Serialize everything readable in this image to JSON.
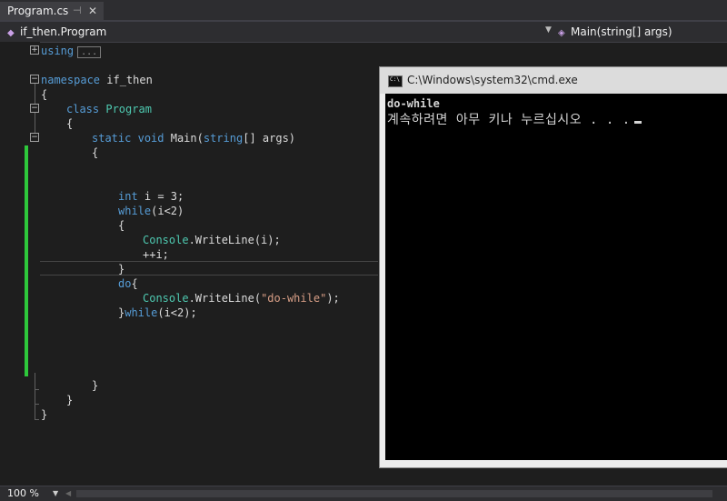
{
  "tab": {
    "label": "Program.cs",
    "pin": "⊣",
    "close": "✕"
  },
  "nav": {
    "class_combo": "if_then.Program",
    "member_combo": "Main(string[] args)"
  },
  "code": {
    "l1_kw": "using",
    "l1_collapsed": "...",
    "l3_kw": "namespace",
    "l3_name": " if_then",
    "l4": "{",
    "l5_kw": "class",
    "l5_ty": "Program",
    "l6": "{",
    "l7_kw1": "static",
    "l7_kw2": "void",
    "l7_mid": " Main(",
    "l7_kw3": "string",
    "l7_end": "[] args)",
    "l8": "{",
    "l11_kw": "int",
    "l11_rest": " i = 3;",
    "l12_kw": "while",
    "l12_rest": "(i<2)",
    "l13": "{",
    "l14_ty": "Console",
    "l14_rest": ".WriteLine(i);",
    "l15": "++i;",
    "l16": "}",
    "l17_kw": "do",
    "l17_rest": "{",
    "l18_ty": "Console",
    "l18_a": ".WriteLine(",
    "l18_str": "\"do-while\"",
    "l18_b": ");",
    "l19_a": "}",
    "l19_kw": "while",
    "l19_rest": "(i<2);",
    "l24": "}",
    "l25": "}",
    "l26": "}"
  },
  "console": {
    "title": "C:\\Windows\\system32\\cmd.exe",
    "icon_text": "C:\\",
    "output_line1": "do-while",
    "output_line2": "계속하려면 아무 키나 누르십시오 . . ."
  },
  "status": {
    "zoom": "100 %"
  },
  "colors": {
    "keyword": "#569cd6",
    "type": "#4ec9b0",
    "string": "#d69d85",
    "change_bar": "#2ec83b"
  },
  "icons": [
    "pin-icon",
    "close-icon",
    "class-icon",
    "method-icon",
    "console-icon"
  ]
}
